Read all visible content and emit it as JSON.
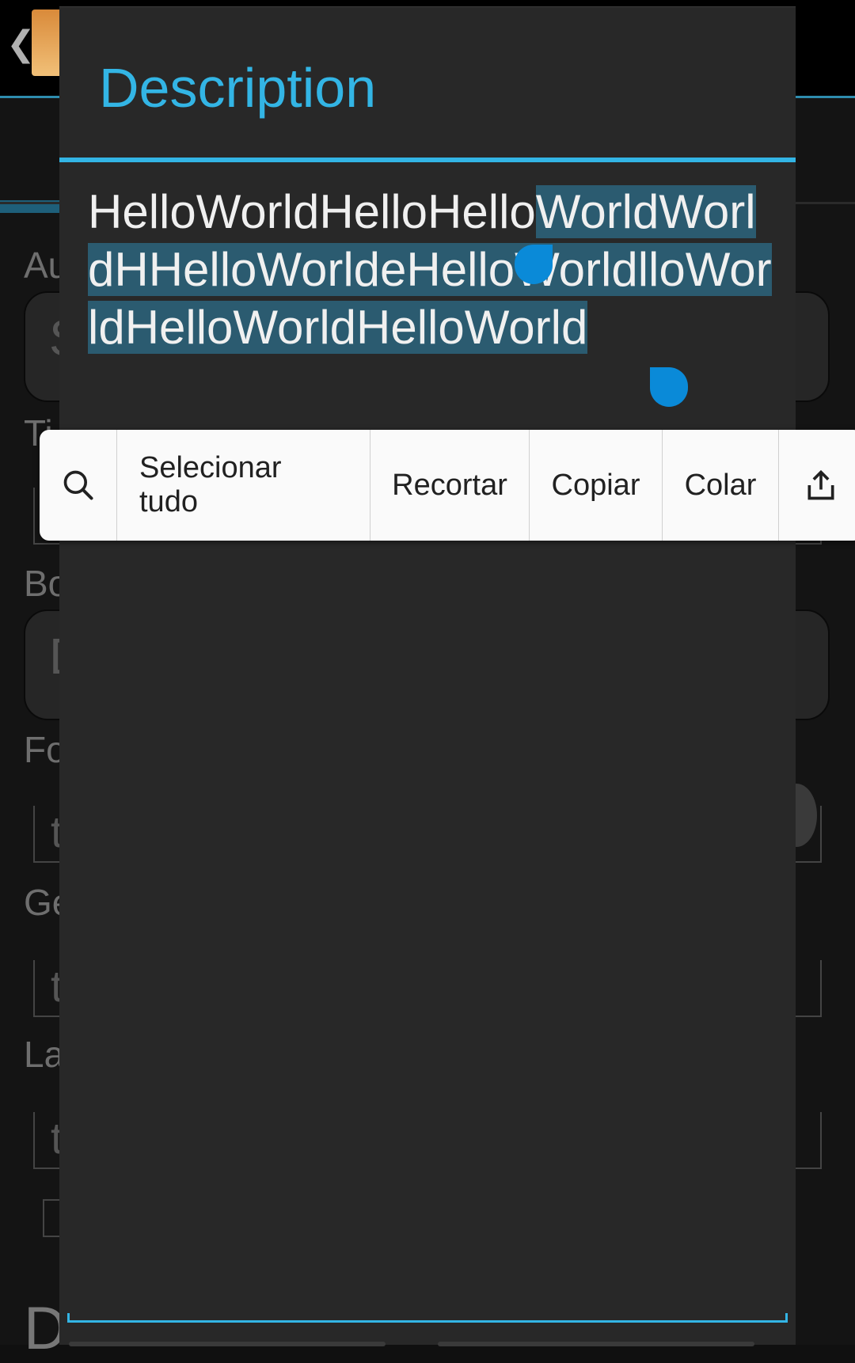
{
  "background": {
    "back_glyph": "❮",
    "labels": [
      "Au",
      "Ti",
      "Bo",
      "Fo",
      "Ge",
      "La"
    ],
    "input_values": [
      "S",
      "D"
    ],
    "field_values": [
      "t",
      "t",
      "t"
    ],
    "big_letter": "D"
  },
  "dialog": {
    "title": "Description",
    "text_before_selection": "HelloWorldHelloHello",
    "text_selected": "WorldWorldHHelloWorldeHelloWorldlloWorldHelloWorldHelloWorld"
  },
  "toolbar": {
    "search_icon": "search-icon",
    "select_all": "Selecionar tudo",
    "cut": "Recortar",
    "copy": "Copiar",
    "paste": "Colar",
    "share_icon": "share-icon"
  },
  "colors": {
    "accent": "#33b5e5",
    "selection": "#2b5b70",
    "handle": "#0a8ad8",
    "dialog_bg": "#282828"
  }
}
